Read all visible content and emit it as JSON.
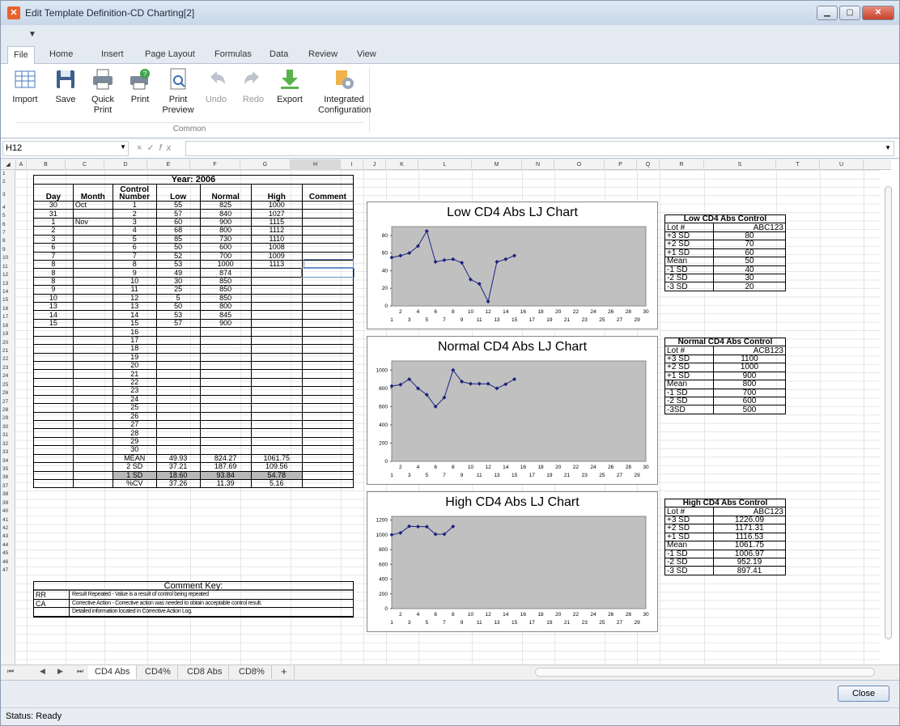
{
  "window": {
    "title": "Edit Template Definition-CD Charting[2]"
  },
  "ribbon": {
    "tabs": [
      "File",
      "Home",
      "Insert",
      "Page Layout",
      "Formulas",
      "Data",
      "Review",
      "View"
    ],
    "buttons": [
      {
        "label": "Import",
        "icon": "table-icon",
        "enabled": true
      },
      {
        "label": "Save",
        "icon": "floppy-disk-icon",
        "enabled": true
      },
      {
        "label": "Quick\nPrint",
        "icon": "printer-icon",
        "enabled": true
      },
      {
        "label": "Print",
        "icon": "printer-settings-icon",
        "enabled": true
      },
      {
        "label": "Print\nPreview",
        "icon": "print-preview-icon",
        "enabled": true
      },
      {
        "label": "Undo",
        "icon": "undo-icon",
        "enabled": false
      },
      {
        "label": "Redo",
        "icon": "redo-icon",
        "enabled": false
      },
      {
        "label": "Export",
        "icon": "export-icon",
        "enabled": true
      },
      {
        "label": "Integrated\nConfiguration",
        "icon": "configuration-icon",
        "enabled": true
      }
    ],
    "group_label": "Common"
  },
  "formula_bar": {
    "name_box": "H12",
    "formula": ""
  },
  "columns": [
    "A",
    "B",
    "C",
    "D",
    "E",
    "F",
    "G",
    "H",
    "I",
    "J",
    "K",
    "L",
    "M",
    "N",
    "O",
    "P",
    "Q",
    "R",
    "S",
    "T",
    "U"
  ],
  "rows": [
    "1",
    "2",
    "3",
    "4",
    "5",
    "6",
    "7",
    "8",
    "9",
    "10",
    "11",
    "12",
    "13",
    "14",
    "15",
    "16",
    "17",
    "18",
    "19",
    "20",
    "21",
    "22",
    "23",
    "24",
    "25",
    "26",
    "27",
    "28",
    "29",
    "30",
    "31",
    "32",
    "33",
    "34",
    "35",
    "36",
    "37",
    "38",
    "39",
    "40",
    "41",
    "42",
    "43",
    "44",
    "45",
    "46",
    "47"
  ],
  "data_table": {
    "year_title": "Year: 2006",
    "headers": [
      "Day",
      "Month",
      "Control\nNumber",
      "Low",
      "Normal",
      "High",
      "Comment"
    ],
    "rows": [
      [
        "30",
        "Oct",
        "1",
        "55",
        "825",
        "1000",
        ""
      ],
      [
        "31",
        "",
        "2",
        "57",
        "840",
        "1027",
        ""
      ],
      [
        "1",
        "Nov",
        "3",
        "60",
        "900",
        "1115",
        ""
      ],
      [
        "2",
        "",
        "4",
        "68",
        "800",
        "1112",
        ""
      ],
      [
        "3",
        "",
        "5",
        "85",
        "730",
        "1110",
        ""
      ],
      [
        "6",
        "",
        "6",
        "50",
        "600",
        "1008",
        ""
      ],
      [
        "7",
        "",
        "7",
        "52",
        "700",
        "1009",
        ""
      ],
      [
        "8",
        "",
        "8",
        "53",
        "1000",
        "1113",
        ""
      ],
      [
        "8",
        "",
        "9",
        "49",
        "874",
        "",
        ""
      ],
      [
        "8",
        "",
        "10",
        "30",
        "850",
        "",
        ""
      ],
      [
        "9",
        "",
        "11",
        "25",
        "850",
        "",
        ""
      ],
      [
        "10",
        "",
        "12",
        "5",
        "850",
        "",
        ""
      ],
      [
        "13",
        "",
        "13",
        "50",
        "800",
        "",
        ""
      ],
      [
        "14",
        "",
        "14",
        "53",
        "845",
        "",
        ""
      ],
      [
        "15",
        "",
        "15",
        "57",
        "900",
        "",
        ""
      ],
      [
        "",
        "",
        "16",
        "",
        "",
        "",
        ""
      ],
      [
        "",
        "",
        "17",
        "",
        "",
        "",
        ""
      ],
      [
        "",
        "",
        "18",
        "",
        "",
        "",
        ""
      ],
      [
        "",
        "",
        "19",
        "",
        "",
        "",
        ""
      ],
      [
        "",
        "",
        "20",
        "",
        "",
        "",
        ""
      ],
      [
        "",
        "",
        "21",
        "",
        "",
        "",
        ""
      ],
      [
        "",
        "",
        "22",
        "",
        "",
        "",
        ""
      ],
      [
        "",
        "",
        "23",
        "",
        "",
        "",
        ""
      ],
      [
        "",
        "",
        "24",
        "",
        "",
        "",
        ""
      ],
      [
        "",
        "",
        "25",
        "",
        "",
        "",
        ""
      ],
      [
        "",
        "",
        "26",
        "",
        "",
        "",
        ""
      ],
      [
        "",
        "",
        "27",
        "",
        "",
        "",
        ""
      ],
      [
        "",
        "",
        "28",
        "",
        "",
        "",
        ""
      ],
      [
        "",
        "",
        "29",
        "",
        "",
        "",
        ""
      ],
      [
        "",
        "",
        "30",
        "",
        "",
        "",
        ""
      ]
    ],
    "stats": [
      [
        "MEAN",
        "49.93",
        "824.27",
        "1061.75"
      ],
      [
        "2 SD",
        "37.21",
        "187.69",
        "109.56"
      ],
      [
        "1 SD",
        "18.60",
        "93.84",
        "54.78"
      ],
      [
        "%CV",
        "37.26",
        "11.39",
        "5.16"
      ]
    ]
  },
  "comment_key": {
    "title": "Comment Key:",
    "entries": [
      {
        "code": "RR",
        "text": "Result Repeated - Value is a result of control being repeated"
      },
      {
        "code": "CA",
        "text": "Corrective Action - Corrective action was needed to obtain acceptable control result."
      },
      {
        "code": "",
        "text": "Detailed information located in Corrective Action Log."
      }
    ]
  },
  "controls": [
    {
      "title": "Low CD4 Abs Control",
      "lot": "ABC123",
      "rows": [
        [
          "+3 SD",
          "80"
        ],
        [
          "+2 SD",
          "70"
        ],
        [
          "+1 SD",
          "60"
        ],
        [
          "Mean",
          "50"
        ],
        [
          "-1 SD",
          "40"
        ],
        [
          "-2 SD",
          "30"
        ],
        [
          "-3 SD",
          "20"
        ]
      ]
    },
    {
      "title": "Normal CD4 Abs Control",
      "lot": "ACB123",
      "rows": [
        [
          "+3 SD",
          "1100"
        ],
        [
          "+2 SD",
          "1000"
        ],
        [
          "+1 SD",
          "900"
        ],
        [
          "Mean",
          "800"
        ],
        [
          "-1 SD",
          "700"
        ],
        [
          "-2 SD",
          "600"
        ],
        [
          "-3SD",
          "500"
        ]
      ]
    },
    {
      "title": "High CD4 Abs Control",
      "lot": "ABC123",
      "rows": [
        [
          "+3 SD",
          "1226.09"
        ],
        [
          "+2 SD",
          "1171.31"
        ],
        [
          "+1 SD",
          "1116.53"
        ],
        [
          "Mean",
          "1061.75"
        ],
        [
          "-1 SD",
          "1006.97"
        ],
        [
          "-2 SD",
          "952.19"
        ],
        [
          "-3 SD",
          "897.41"
        ]
      ]
    }
  ],
  "lot_label": "Lot #",
  "chart_data": [
    {
      "type": "line",
      "title": "Low CD4 Abs LJ Chart",
      "x": [
        1,
        2,
        3,
        4,
        5,
        6,
        7,
        8,
        9,
        10,
        11,
        12,
        13,
        14,
        15
      ],
      "values": [
        55,
        57,
        60,
        68,
        85,
        50,
        52,
        53,
        49,
        30,
        25,
        5,
        50,
        53,
        57
      ],
      "ylim": [
        0,
        90
      ],
      "yticks": [
        0,
        20,
        40,
        60,
        80
      ],
      "xlim": [
        1,
        30
      ]
    },
    {
      "type": "line",
      "title": "Normal CD4 Abs  LJ Chart",
      "x": [
        1,
        2,
        3,
        4,
        5,
        6,
        7,
        8,
        9,
        10,
        11,
        12,
        13,
        14,
        15
      ],
      "values": [
        825,
        840,
        900,
        800,
        730,
        600,
        700,
        1000,
        874,
        850,
        850,
        850,
        800,
        845,
        900
      ],
      "ylim": [
        0,
        1100
      ],
      "yticks": [
        0,
        200,
        400,
        600,
        800,
        1000
      ],
      "xlim": [
        1,
        30
      ]
    },
    {
      "type": "line",
      "title": "High CD4 Abs LJ Chart",
      "x": [
        1,
        2,
        3,
        4,
        5,
        6,
        7,
        8
      ],
      "values": [
        1000,
        1027,
        1115,
        1112,
        1110,
        1008,
        1009,
        1113
      ],
      "ylim": [
        0,
        1250
      ],
      "yticks": [
        0,
        200,
        400,
        600,
        800,
        1000,
        1200
      ],
      "xlim": [
        1,
        30
      ]
    }
  ],
  "sheet_tabs": [
    "CD4 Abs",
    "CD4%",
    "CD8 Abs",
    "CD8%"
  ],
  "active_sheet": "CD4 Abs",
  "add_sheet": "+",
  "close_label": "Close",
  "status": "Status: Ready"
}
